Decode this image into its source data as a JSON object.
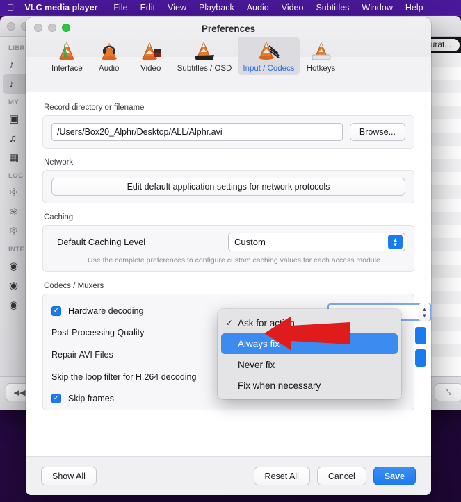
{
  "menubar": {
    "apple_icon": "apple-logo-icon",
    "items": [
      "VLC media player",
      "File",
      "Edit",
      "View",
      "Playback",
      "Audio",
      "Video",
      "Subtitles",
      "Window",
      "Help"
    ],
    "background_color": "#4a189a"
  },
  "vlc_window": {
    "sidebar": {
      "sections": [
        {
          "header": "LIBR",
          "items": [
            "playlist-icon",
            "playlist-icon"
          ]
        },
        {
          "header": "MY",
          "items": [
            "film-icon",
            "music-note-icon",
            "image-icon"
          ]
        },
        {
          "header": "LOC",
          "items": [
            "globe-icon",
            "globe-icon",
            "globe-icon"
          ]
        },
        {
          "header": "INTE",
          "items": [
            "podcast-icon",
            "podcast-icon",
            "podcast-icon"
          ]
        }
      ]
    },
    "playlist_column_header": "Durat...",
    "controls": {
      "rewind": "◀◀",
      "fullscreen": "⤡"
    }
  },
  "prefs": {
    "title": "Preferences",
    "toolbar": [
      {
        "label": "Interface",
        "icon": "vlc-cone-interface-icon",
        "active": false
      },
      {
        "label": "Audio",
        "icon": "vlc-cone-audio-icon",
        "active": false
      },
      {
        "label": "Video",
        "icon": "vlc-cone-video-icon",
        "active": false
      },
      {
        "label": "Subtitles / OSD",
        "icon": "vlc-cone-subtitles-icon",
        "active": false
      },
      {
        "label": "Input / Codecs",
        "icon": "vlc-cone-input-codecs-icon",
        "active": true
      },
      {
        "label": "Hotkeys",
        "icon": "vlc-cone-hotkeys-icon",
        "active": false
      }
    ],
    "record": {
      "group_label": "Record directory or filename",
      "path_value": "/Users/Box20_Alphr/Desktop/ALL/Alphr.avi",
      "path_placeholder": "Record directory or filename",
      "browse_label": "Browse..."
    },
    "network": {
      "group_label": "Network",
      "edit_button_label": "Edit default application settings for network protocols"
    },
    "caching": {
      "group_label": "Caching",
      "level_label": "Default Caching Level",
      "level_value": "Custom",
      "hint": "Use the complete preferences to configure custom caching values for each access module."
    },
    "codecs": {
      "group_label": "Codecs / Muxers",
      "hardware_decoding_label": "Hardware decoding",
      "hardware_decoding_checked": true,
      "post_processing_label": "Post-Processing Quality",
      "post_processing_value": "6",
      "repair_avi_label": "Repair AVI Files",
      "skip_loop_filter_label": "Skip the loop filter for H.264 decoding",
      "skip_frames_label": "Skip frames",
      "skip_frames_checked": true
    },
    "dropdown": {
      "items": [
        {
          "label": "Ask for action",
          "checked": true,
          "selected": false
        },
        {
          "label": "Always fix",
          "checked": false,
          "selected": true
        },
        {
          "label": "Never fix",
          "checked": false,
          "selected": false
        },
        {
          "label": "Fix when necessary",
          "checked": false,
          "selected": false
        }
      ],
      "highlight_color": "#3b8bf0"
    },
    "annotation": {
      "arrow_color": "#e01b1b",
      "points_to": "Always fix"
    },
    "footer": {
      "show_all_label": "Show All",
      "reset_all_label": "Reset All",
      "cancel_label": "Cancel",
      "save_label": "Save"
    }
  },
  "colors": {
    "accent": "#1a7bf0",
    "menubar": "#4a189a",
    "desktop": "#2b0a4a"
  }
}
